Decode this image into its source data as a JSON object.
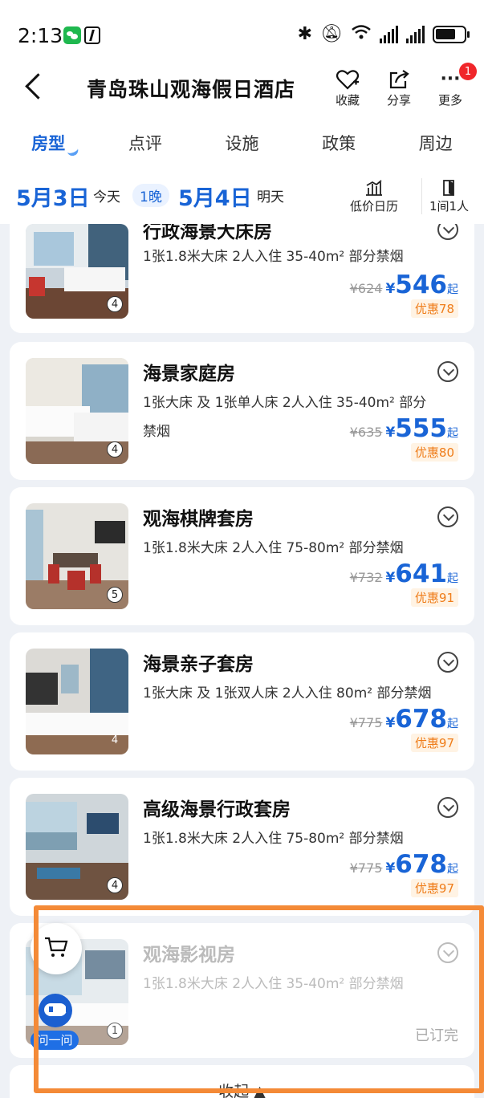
{
  "status_bar": {
    "time": "2:13"
  },
  "header": {
    "title": "青岛珠山观海假日酒店",
    "actions": [
      {
        "label": "收藏",
        "icon": "heart-plus-icon"
      },
      {
        "label": "分享",
        "icon": "share-icon"
      },
      {
        "label": "更多",
        "icon": "more-icon",
        "badge": "1"
      }
    ]
  },
  "tabs": [
    "房型",
    "点评",
    "设施",
    "政策",
    "周边"
  ],
  "active_tab": "房型",
  "dates": {
    "checkin": "5月3日",
    "checkin_day": "今天",
    "nights": "1晚",
    "checkout": "5月4日",
    "checkout_day": "明天",
    "calendar_label": "低价日历",
    "rooms_label": "1间1人"
  },
  "rooms": [
    {
      "name": "行政海景大床房",
      "info": "1张1.8米大床  2人入住  35-40m²  部分禁烟",
      "photos": "4",
      "orig_price": "¥624",
      "currency": "¥",
      "price": "546",
      "unit": "起",
      "discount": "优惠78"
    },
    {
      "name": "海景家庭房",
      "info": "1张大床 及 1张单人床  2人入住  35-40m²  部分禁烟",
      "photos": "4",
      "orig_price": "¥635",
      "currency": "¥",
      "price": "555",
      "unit": "起",
      "discount": "优惠80"
    },
    {
      "name": "观海棋牌套房",
      "info": "1张1.8米大床  2人入住  75-80m²  部分禁烟",
      "photos": "5",
      "orig_price": "¥732",
      "currency": "¥",
      "price": "641",
      "unit": "起",
      "discount": "优惠91"
    },
    {
      "name": "海景亲子套房",
      "info": "1张大床 及 1张双人床  2人入住  80m²  部分禁烟",
      "photos": "4",
      "orig_price": "¥775",
      "currency": "¥",
      "price": "678",
      "unit": "起",
      "discount": "优惠97"
    },
    {
      "name": "高级海景行政套房",
      "info": "1张1.8米大床  2人入住  75-80m²  部分禁烟",
      "photos": "4",
      "orig_price": "¥775",
      "currency": "¥",
      "price": "678",
      "unit": "起",
      "discount": "优惠97"
    },
    {
      "name": "观海影视房",
      "info": "1张1.8米大床  2人入住  35-40m²  部分禁烟",
      "photos": "1",
      "status": "已订完"
    }
  ],
  "collapse_label": "收起 ▲",
  "assistant_label": "问一问",
  "colors": {
    "accent": "#1964d6",
    "discount": "#ef7d1a",
    "highlight": "#f48a37",
    "badge": "#f0262a"
  }
}
